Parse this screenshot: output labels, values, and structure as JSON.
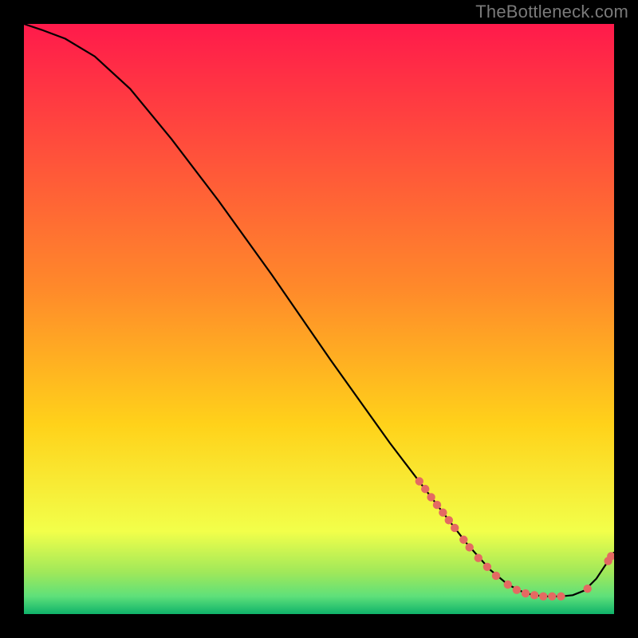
{
  "watermark": "TheBottleneck.com",
  "chart_data": {
    "type": "line",
    "title": "",
    "xlabel": "",
    "ylabel": "",
    "xlim": [
      0,
      100
    ],
    "ylim": [
      0,
      100
    ],
    "curve": [
      {
        "x": 0,
        "y": 100
      },
      {
        "x": 3,
        "y": 99
      },
      {
        "x": 7,
        "y": 97.5
      },
      {
        "x": 12,
        "y": 94.5
      },
      {
        "x": 18,
        "y": 89
      },
      {
        "x": 25,
        "y": 80.5
      },
      {
        "x": 33,
        "y": 70
      },
      {
        "x": 42,
        "y": 57.5
      },
      {
        "x": 52,
        "y": 43
      },
      {
        "x": 62,
        "y": 29
      },
      {
        "x": 70,
        "y": 18.5
      },
      {
        "x": 75,
        "y": 12
      },
      {
        "x": 79,
        "y": 7.5
      },
      {
        "x": 82,
        "y": 5
      },
      {
        "x": 85,
        "y": 3.5
      },
      {
        "x": 88,
        "y": 3
      },
      {
        "x": 91,
        "y": 3
      },
      {
        "x": 93,
        "y": 3.2
      },
      {
        "x": 95,
        "y": 4
      },
      {
        "x": 97,
        "y": 6
      },
      {
        "x": 99,
        "y": 9
      },
      {
        "x": 100,
        "y": 10.5
      }
    ],
    "points": [
      {
        "x": 67,
        "y": 22.5
      },
      {
        "x": 68,
        "y": 21.2
      },
      {
        "x": 69,
        "y": 19.8
      },
      {
        "x": 70,
        "y": 18.5
      },
      {
        "x": 71,
        "y": 17.2
      },
      {
        "x": 72,
        "y": 15.9
      },
      {
        "x": 73,
        "y": 14.6
      },
      {
        "x": 74.5,
        "y": 12.6
      },
      {
        "x": 75.5,
        "y": 11.3
      },
      {
        "x": 77,
        "y": 9.5
      },
      {
        "x": 78.5,
        "y": 8.0
      },
      {
        "x": 80,
        "y": 6.5
      },
      {
        "x": 82,
        "y": 5.0
      },
      {
        "x": 83.5,
        "y": 4.1
      },
      {
        "x": 85,
        "y": 3.5
      },
      {
        "x": 86.5,
        "y": 3.2
      },
      {
        "x": 88,
        "y": 3.0
      },
      {
        "x": 89.5,
        "y": 3.0
      },
      {
        "x": 91,
        "y": 3.0
      },
      {
        "x": 95.5,
        "y": 4.3
      },
      {
        "x": 99,
        "y": 9.0
      },
      {
        "x": 99.5,
        "y": 9.8
      }
    ],
    "colors": {
      "top": "#ff1a4b",
      "mid": "#ffd21a",
      "bottom_upper": "#5ee07a",
      "bottom_lower": "#0fb36a",
      "line": "#000000",
      "point": "#e46a62"
    }
  }
}
